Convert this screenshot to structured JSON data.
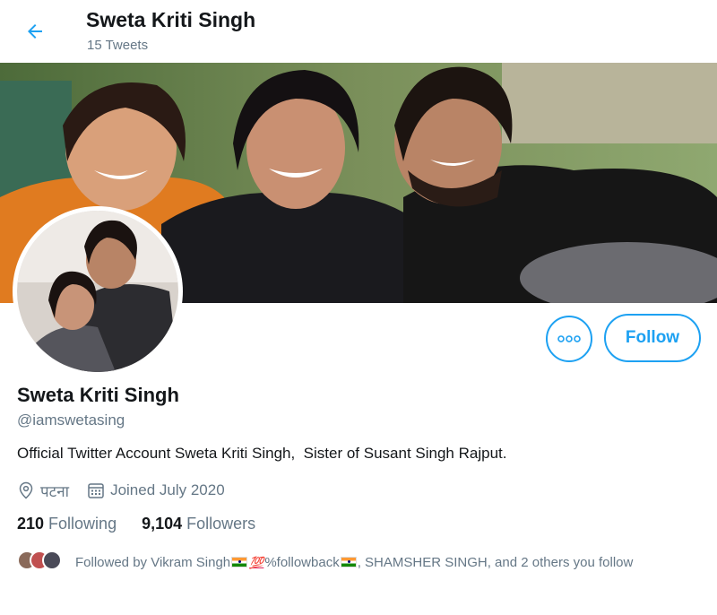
{
  "header": {
    "name": "Sweta Kriti Singh",
    "tweet_count": "15 Tweets"
  },
  "profile": {
    "name": "Sweta Kriti Singh",
    "handle": "@iamswetasing",
    "bio": "Official Twitter Account Sweta Kriti Singh,  Sister of Susant Singh Rajput.",
    "location": "पटना",
    "joined": "Joined July 2020"
  },
  "stats": {
    "following_count": "210",
    "following_label": "Following",
    "followers_count": "9,104",
    "followers_label": "Followers"
  },
  "actions": {
    "follow_label": "Follow"
  },
  "followed_by": {
    "prefix": "Followed by Vikram Singh",
    "hundred": "💯",
    "mid": "%followback",
    "suffix": ", SHAMSHER SINGH, and 2 others you follow"
  },
  "colors": {
    "accent": "#1da1f2",
    "secondary_text": "#657786",
    "primary_text": "#14171a"
  },
  "icons": [
    "back-arrow-icon",
    "more-icon",
    "location-icon",
    "calendar-icon",
    "india-flag-icon"
  ]
}
